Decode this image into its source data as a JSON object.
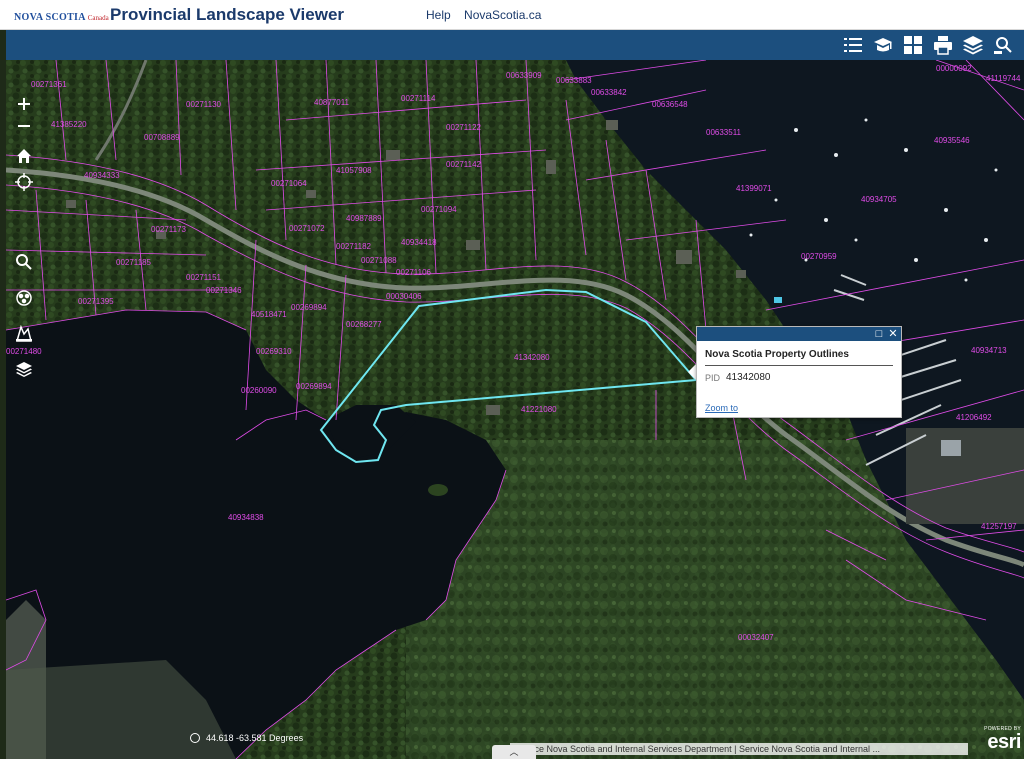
{
  "header": {
    "logo_text": "NOVA SCOTIA",
    "logo_sub": "Canada",
    "title": "Provincial Landscape Viewer",
    "links": [
      "Help",
      "NovaScotia.ca"
    ]
  },
  "toolbar": {
    "buttons": [
      "legend-icon",
      "basemap-gallery-icon",
      "grid-icon",
      "print-icon",
      "layers-icon",
      "search-icon"
    ]
  },
  "map_controls": [
    "zoom-in-icon",
    "zoom-out-icon",
    "home-icon",
    "locate-icon",
    "search-icon",
    "measure-icon",
    "draw-icon",
    "layers-icon"
  ],
  "parcel_labels": [
    "00633909",
    "00633883",
    "00633842",
    "00636548",
    "00633511",
    "40935546",
    "40934705",
    "40934713",
    "41206492",
    "41257197",
    "00270959",
    "41399071",
    "41342080",
    "41221080",
    "40934838",
    "00030406",
    "00271346",
    "00271185",
    "00271072",
    "40934418",
    "00271088",
    "41057908",
    "40877011",
    "00271122",
    "41385220",
    "00708889",
    "40987889",
    "00271064",
    "00271094",
    "00271130",
    "00271173",
    "00271182",
    "00271151",
    "00271480",
    "00271395",
    "00032407",
    "00269894",
    "00269894",
    "00269310",
    "00260090",
    "40518471",
    "00268277",
    "00271361",
    "00271114",
    "40934333",
    "00271106",
    "00271142",
    "41119744",
    "00000092"
  ],
  "popup": {
    "title": "Nova Scotia Property Outlines",
    "field_name": "PID",
    "field_value": "41342080",
    "zoom_label": "Zoom to"
  },
  "status": {
    "coordinates": "44.618 -63.581 Degrees"
  },
  "attribution": "Service Nova Scotia and Internal Services Department | Service Nova Scotia and Internal ...",
  "esri": {
    "powered": "POWERED BY",
    "brand": "esri"
  },
  "colors": {
    "header_bg": "#ffffff",
    "title": "#1b3a6b",
    "toolbar_bg": "#1c4f7e",
    "parcel_line": "#e04ce8",
    "selection": "#6fe6f0",
    "water": "#0c1218",
    "forest": "#263c1c"
  }
}
